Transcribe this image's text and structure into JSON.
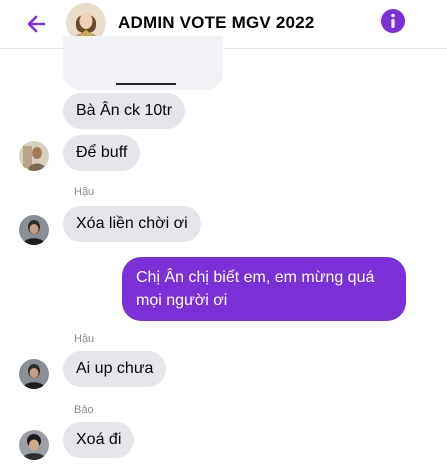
{
  "header": {
    "title": "ADMIN VOTE MGV 2022"
  },
  "colors": {
    "accent": "#7b2fd6",
    "incoming_bubble": "#e4e6eb"
  },
  "messages": [
    {
      "text": "Bà Ân ck 10tr"
    },
    {
      "text": "Để buff"
    },
    {
      "sender": "Hậu",
      "text": "Xóa liền chời ơi"
    },
    {
      "text": "Chị Ân chị biết em, em mừng quá mọi người ơi"
    },
    {
      "sender": "Hậu",
      "text": "Ai up chưa"
    },
    {
      "sender": "Bảo",
      "text": "Xoá đi"
    }
  ]
}
